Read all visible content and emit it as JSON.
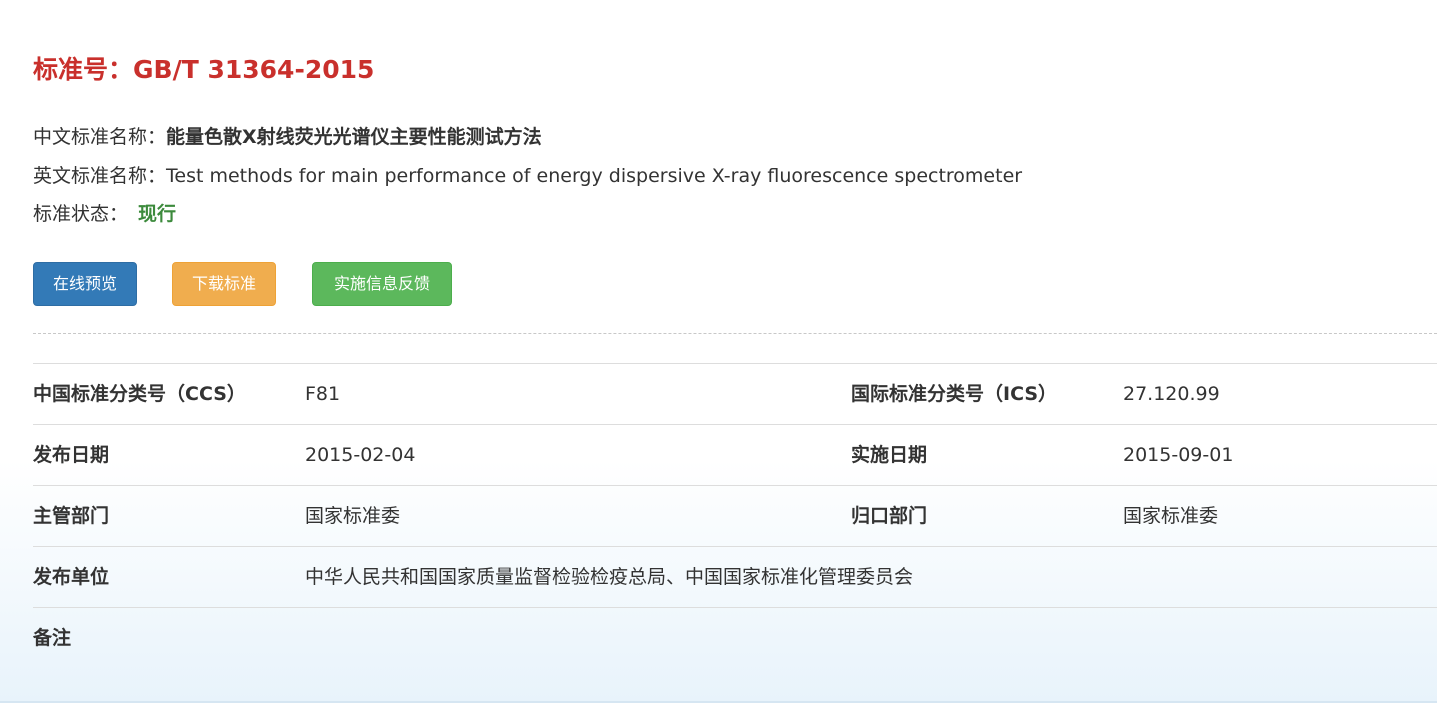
{
  "header": {
    "title": "标准号：GB/T 31364-2015"
  },
  "info": {
    "cn_name_label": "中文标准名称：",
    "cn_name_value": "能量色散X射线荧光光谱仪主要性能测试方法",
    "en_name_label": "英文标准名称：",
    "en_name_value": "Test methods for main performance of energy dispersive X-ray fluorescence spectrometer",
    "status_label": "标准状态：",
    "status_value": "现行"
  },
  "buttons": {
    "preview": "在线预览",
    "download": "下载标准",
    "feedback": "实施信息反馈"
  },
  "colors": {
    "title": "#c9302c",
    "status": "#3c8a3c",
    "preview_button": "#337ab7",
    "download_button": "#f0ad4e",
    "feedback_button": "#5cb85c"
  },
  "details": {
    "rows": [
      {
        "label1": "中国标准分类号（CCS）",
        "value1": "F81",
        "label2": "国际标准分类号（ICS）",
        "value2": "27.120.99"
      },
      {
        "label1": "发布日期",
        "value1": "2015-02-04",
        "label2": "实施日期",
        "value2": "2015-09-01"
      },
      {
        "label1": "主管部门",
        "value1": "国家标准委",
        "label2": "归口部门",
        "value2": "国家标准委"
      },
      {
        "label1": "发布单位",
        "value1": "中华人民共和国国家质量监督检验检疫总局、中国国家标准化管理委员会",
        "label2": "",
        "value2": ""
      },
      {
        "label1": "备注",
        "value1": "",
        "label2": "",
        "value2": ""
      }
    ]
  }
}
